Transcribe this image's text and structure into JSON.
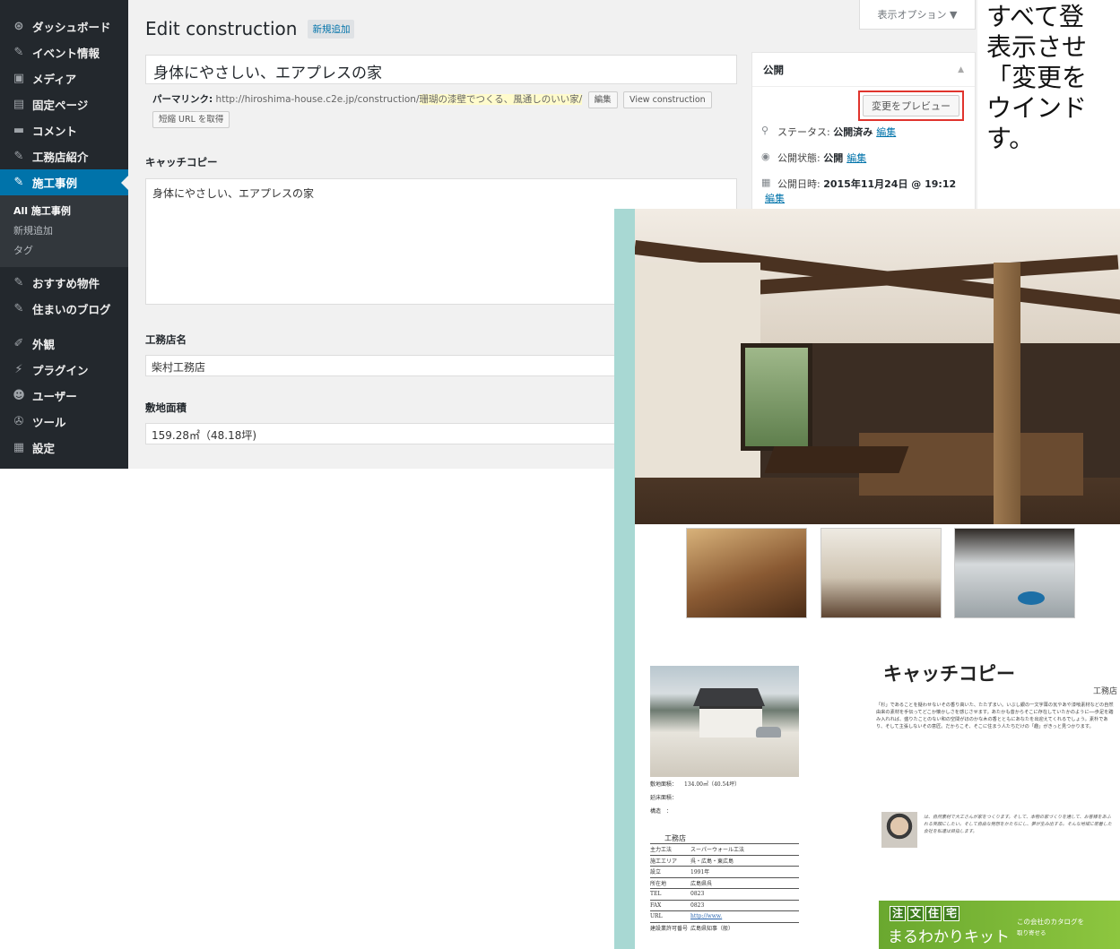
{
  "sidebar": {
    "items_top": [
      {
        "icon": "dashboard-icon",
        "glyph": "⊛",
        "label": "ダッシュボード"
      },
      {
        "icon": "pin-icon",
        "glyph": "✎",
        "label": "イベント情報"
      },
      {
        "icon": "media-icon",
        "glyph": "▣",
        "label": "メディア"
      },
      {
        "icon": "page-icon",
        "glyph": "▤",
        "label": "固定ページ"
      },
      {
        "icon": "comment-icon",
        "glyph": "▬",
        "label": "コメント"
      },
      {
        "icon": "pin-icon",
        "glyph": "✎",
        "label": "工務店紹介"
      },
      {
        "icon": "pin-icon",
        "glyph": "✎",
        "label": "施工事例"
      }
    ],
    "submenu": [
      "All 施工事例",
      "新規追加",
      "タグ"
    ],
    "items_mid": [
      {
        "icon": "pin-icon",
        "glyph": "✎",
        "label": "おすすめ物件"
      },
      {
        "icon": "pin-icon",
        "glyph": "✎",
        "label": "住まいのブログ"
      }
    ],
    "items_bottom": [
      {
        "icon": "appearance-icon",
        "glyph": "✐",
        "label": "外観"
      },
      {
        "icon": "plugin-icon",
        "glyph": "⚡",
        "label": "プラグイン"
      },
      {
        "icon": "user-icon",
        "glyph": "☻",
        "label": "ユーザー"
      },
      {
        "icon": "tools-icon",
        "glyph": "✇",
        "label": "ツール"
      },
      {
        "icon": "settings-icon",
        "glyph": "▦",
        "label": "設定"
      }
    ]
  },
  "header": {
    "title": "Edit construction",
    "add_new": "新規追加",
    "screen_options": "表示オプション ▼"
  },
  "post": {
    "title_value": "身体にやさしい、エアプレスの家",
    "permalink_label": "パーマリンク:",
    "permalink_base": "http://hiroshima-house.c2e.jp/construction/",
    "permalink_slug": "珊瑚の漆壁でつくる、風通しのいい家/",
    "edit_btn": "編集",
    "view_btn": "View construction",
    "shortlink_btn": "短縮 URL を取得"
  },
  "fields": {
    "catch_label": "キャッチコピー",
    "catch_value": "身体にやさしい、エアプレスの家",
    "shop_label": "工務店名",
    "shop_value": "柴村工務店",
    "area_label": "敷地面積",
    "area_value": "159.28㎡（48.18坪)"
  },
  "publish": {
    "heading": "公開",
    "collapse": "▲",
    "preview_btn": "変更をプレビュー",
    "status_label": "ステータス:",
    "status_value": "公開済み",
    "status_edit": "編集",
    "visibility_label": "公開状態:",
    "visibility_value": "公開",
    "visibility_edit": "編集",
    "date_label": "公開日時:",
    "date_value": "2015年11月24日 @ 19:12",
    "date_edit": "編集"
  },
  "instruction": {
    "lines": [
      "すべて登",
      "表示させ",
      "「変更を",
      "ウインド",
      "す。"
    ]
  },
  "preview_page": {
    "catch_heading": "キャッチコピー",
    "shop_heading": "工務店",
    "body_text": "「杉」であることを疑わせないその香り高いた、たたずまい。いぶし銀の一文字葺の瓦やあや漆喰素材などの自然由来の素材を手伝ってどこか懐かしさを感じさせます。あたかも昔からそこに存在していたかのように──歩足を踏み入れれば、盛りたことのない和の空間がほのかな木の香とともにあなたを出迎えてくれるでしょう。素朴であり、そして主張しないその意匠。だからこそ、そこに住まう人たちだけの「趣」がきっと見つかります。",
    "profile_text": "は、自然素材で大工さんが家をつくります。そして、本物の家づくりを通して、お客様をあふれる笑顔にしたい。そして自由な発想をかたちにし、夢が生み出する。そんな地域に密着した会社を私達は目指します。",
    "specs": [
      {
        "k": "敷地面積：",
        "v": "134.00㎡（40.54坪）"
      },
      {
        "k": "延床面積：",
        "v": ""
      },
      {
        "k": "構造　：",
        "v": ""
      }
    ],
    "shop_table_title": "工務店",
    "shop_table": [
      {
        "k": "主力工法",
        "v": "スーパーウォール工法",
        "link": false
      },
      {
        "k": "施工エリア",
        "v": "呉・広島・東広島",
        "link": false
      },
      {
        "k": "設立",
        "v": "1991年",
        "link": false
      },
      {
        "k": "所在地",
        "v": "広島県呉",
        "link": false
      },
      {
        "k": "TEL",
        "v": "0823",
        "link": false
      },
      {
        "k": "FAX",
        "v": "0823",
        "link": false
      },
      {
        "k": "URL",
        "v": "http://www.",
        "link": true
      },
      {
        "k": "建設業許可番号",
        "v": "広島県知事（般）",
        "link": false
      }
    ],
    "banner_kanji": [
      "注",
      "文",
      "住",
      "宅"
    ],
    "banner_main": "まるわかりキット",
    "banner_side_1": "この会社のカタログを",
    "banner_side_2": "取り寄せる"
  }
}
